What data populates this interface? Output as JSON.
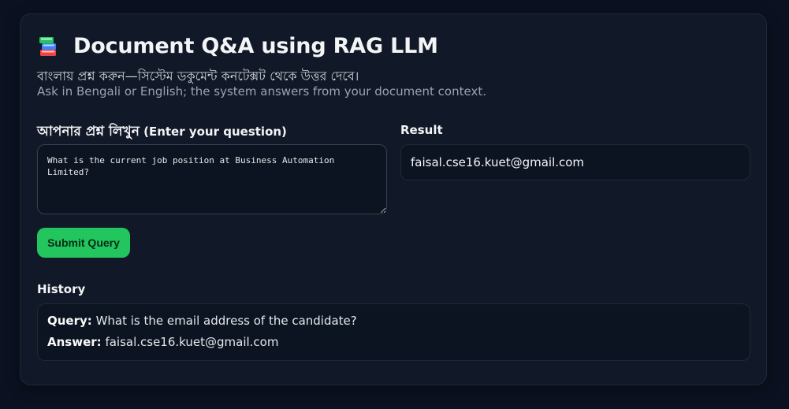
{
  "header": {
    "icon": "books-icon",
    "title": "Document Q&A using RAG LLM",
    "subtitle_bn": "বাংলায় প্রশ্ন করুন—সিস্টেম ডকুমেন্ট কনটেক্সট থেকে উত্তর দেবে।",
    "subtitle_en": "Ask in Bengali or English; the system answers from your document context."
  },
  "question": {
    "label_bn": "আপনার প্রশ্ন লিখুন",
    "label_en": "(Enter your question)",
    "value": "What is the current job position at Business Automation Limited?"
  },
  "result": {
    "label": "Result",
    "value": "faisal.cse16.kuet@gmail.com"
  },
  "submit_label": "Submit Query",
  "history": {
    "label": "History",
    "items": [
      {
        "query_label": "Query:",
        "query": "What is the email address of the candidate?",
        "answer_label": "Answer:",
        "answer": "faisal.cse16.kuet@gmail.com"
      }
    ]
  },
  "colors": {
    "background": "#0b1120",
    "card": "#111827",
    "accent": "#22c55e"
  }
}
